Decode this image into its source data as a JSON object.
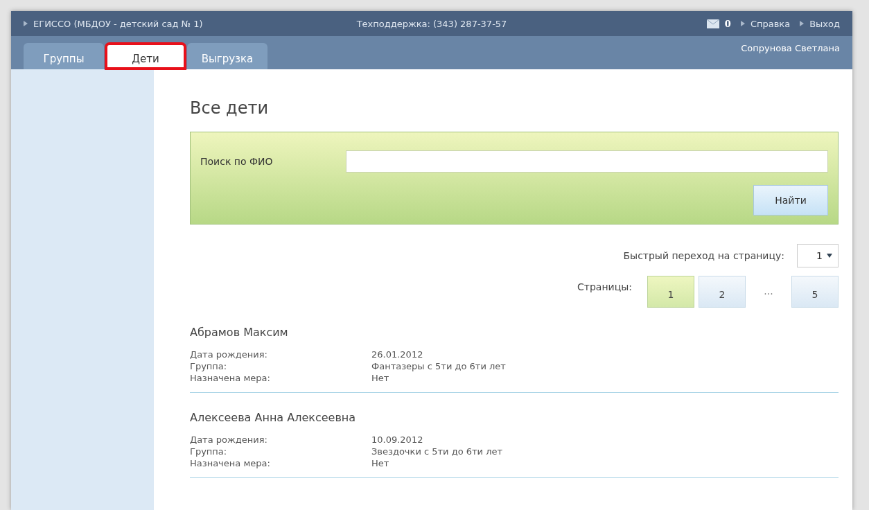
{
  "header": {
    "org": "ЕГИССО (МБДОУ - детский сад № 1)",
    "support": "Техподдержка: (343) 287-37-57",
    "messages_count": "0",
    "links": [
      "Справка",
      "Выход"
    ],
    "user": "Сопрунова Светлана"
  },
  "tabs": [
    {
      "label": "Группы",
      "selected": false,
      "highlighted": false
    },
    {
      "label": "Дети",
      "selected": true,
      "highlighted": true
    },
    {
      "label": "Выгрузка",
      "selected": false,
      "highlighted": false
    }
  ],
  "page_title": "Все дети",
  "search": {
    "label": "Поиск по ФИО",
    "button": "Найти"
  },
  "quick_jump": {
    "label": "Быстрый переход на страницу:",
    "value": "1"
  },
  "pagination": {
    "label": "Страницы:",
    "items": [
      {
        "kind": "page",
        "label": "1",
        "selected": true
      },
      {
        "kind": "page",
        "label": "2",
        "selected": false
      },
      {
        "kind": "ellipsis",
        "label": "..."
      },
      {
        "kind": "page",
        "label": "5",
        "selected": false
      }
    ]
  },
  "children": [
    {
      "name": "Абрамов Максим",
      "fields": [
        {
          "label": "Дата рождения:",
          "value": "26.01.2012"
        },
        {
          "label": "Группа:",
          "value": "Фантазеры с 5ти до 6ти лет"
        },
        {
          "label": "Назначена мера:",
          "value": "Нет"
        }
      ]
    },
    {
      "name": "Алексеева Анна Алексеевна",
      "fields": [
        {
          "label": "Дата рождения:",
          "value": "10.09.2012"
        },
        {
          "label": "Группа:",
          "value": "Звездочки с 5ти до 6ти лет"
        },
        {
          "label": "Назначена мера:",
          "value": "Нет"
        }
      ]
    }
  ]
}
